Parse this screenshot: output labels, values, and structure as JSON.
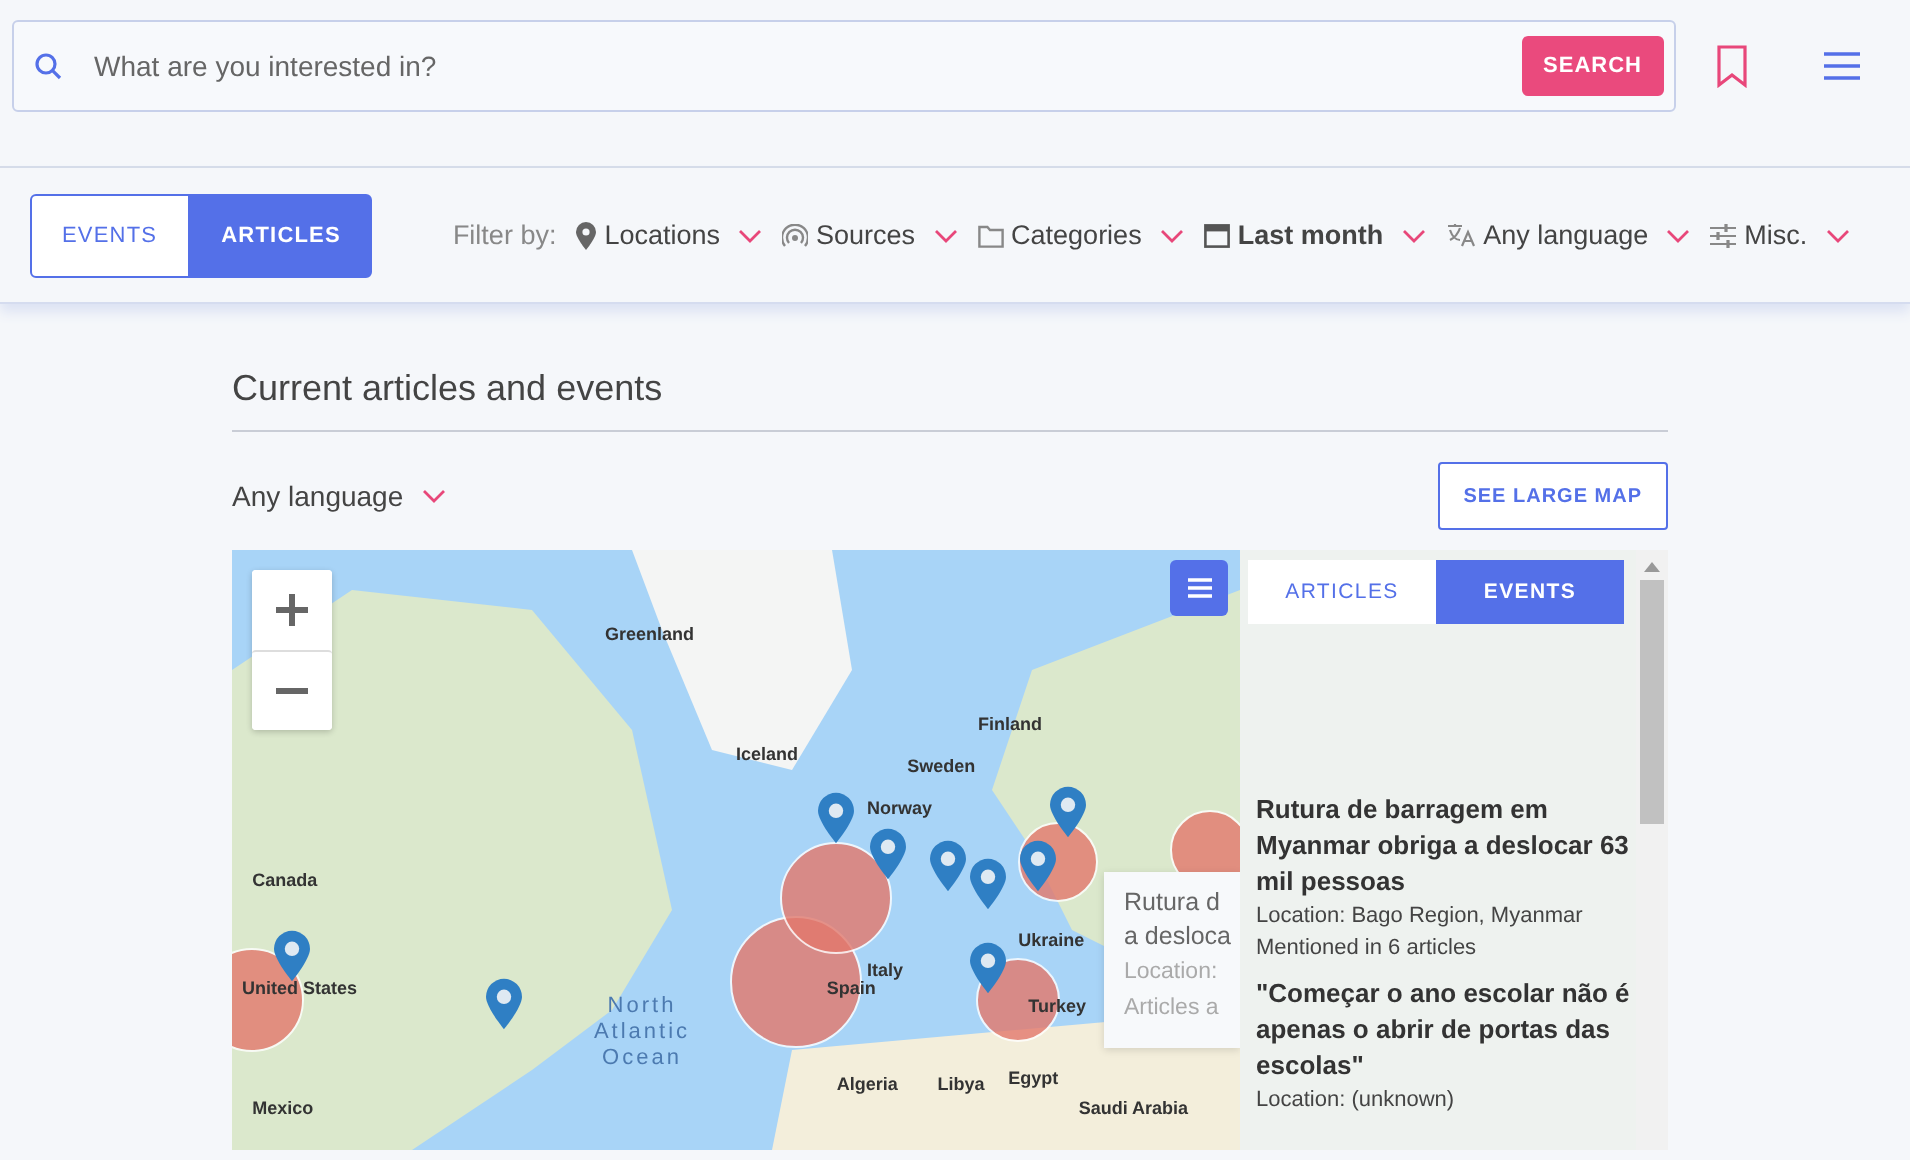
{
  "search": {
    "placeholder": "What are you interested in?",
    "button": "SEARCH"
  },
  "mode_tabs": [
    {
      "label": "EVENTS",
      "selected": false
    },
    {
      "label": "ARTICLES",
      "selected": true
    }
  ],
  "filters": {
    "label": "Filter by:",
    "items": [
      {
        "label": "Locations",
        "kind": "pin",
        "bold": false
      },
      {
        "label": "Sources",
        "kind": "signal",
        "bold": false
      },
      {
        "label": "Categories",
        "kind": "folder",
        "bold": false
      },
      {
        "label": "Last month",
        "kind": "calendar",
        "bold": true
      },
      {
        "label": "Any language",
        "kind": "translate",
        "bold": false
      },
      {
        "label": "Misc.",
        "kind": "sliders",
        "bold": false
      }
    ]
  },
  "section": {
    "title": "Current articles and events",
    "language": "Any language",
    "large_map_button": "SEE LARGE MAP"
  },
  "map": {
    "labels": [
      "Greenland",
      "Iceland",
      "Finland",
      "Sweden",
      "Norway",
      "Canada",
      "Ukraine",
      "Italy",
      "Spain",
      "United States",
      "Turkey",
      "Mexico",
      "Algeria",
      "Libya",
      "Egypt",
      "Saudi Arabia"
    ],
    "ocean_label": "North Atlantic Ocean",
    "tooltip": {
      "title_lines": [
        "Rutura d",
        "a desloca"
      ],
      "location": "Location:",
      "articles": "Articles a"
    }
  },
  "panel": {
    "tabs": [
      {
        "label": "ARTICLES",
        "selected": false
      },
      {
        "label": "EVENTS",
        "selected": true
      }
    ],
    "events": [
      {
        "title": "Rutura de barragem em Myanmar obriga a deslocar 63 mil pessoas",
        "location": "Location: Bago Region, Myanmar",
        "mentions": "Mentioned in 6 articles"
      },
      {
        "title": "\"Começar o ano escolar não é apenas o abrir de portas das escolas\"",
        "location": "Location: (unknown)"
      }
    ]
  }
}
